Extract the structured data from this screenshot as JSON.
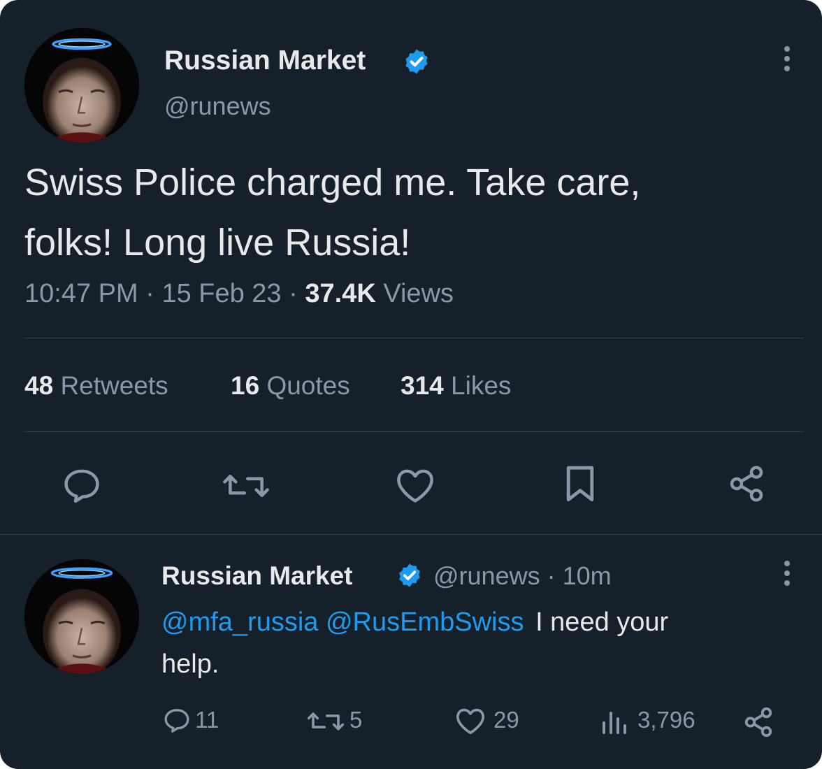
{
  "main_tweet": {
    "author_name": "Russian Market",
    "author_handle": "@runews",
    "text_line1": "Swiss Police charged me. Take care,",
    "text_line2": "folks! Long live Russia!",
    "time": "10:47 PM",
    "separator": "·",
    "date": "15 Feb 23",
    "views_count": "37.4K",
    "views_label": "Views",
    "retweets_count": "48",
    "retweets_label": "Retweets",
    "quotes_count": "16",
    "quotes_label": "Quotes",
    "likes_count": "314",
    "likes_label": "Likes"
  },
  "reply": {
    "author_name": "Russian Market",
    "author_handle": "@runews",
    "separator": "·",
    "time_ago": "10m",
    "mention1": "@mfa_russia",
    "mention2": "@RusEmbSwiss",
    "text_line1": "I need your",
    "text_line2": "help.",
    "reply_count": "11",
    "retweet_count": "5",
    "like_count": "29",
    "view_count": "3,796"
  },
  "colors": {
    "background": "#15202b",
    "text": "#e7e9ea",
    "muted": "#8b98a5",
    "accent": "#1d9bf0",
    "divider": "#38444d"
  },
  "icons": [
    "verified-badge-icon",
    "more-icon",
    "reply-icon",
    "retweet-icon",
    "like-icon",
    "bookmark-icon",
    "share-icon",
    "views-icon"
  ]
}
